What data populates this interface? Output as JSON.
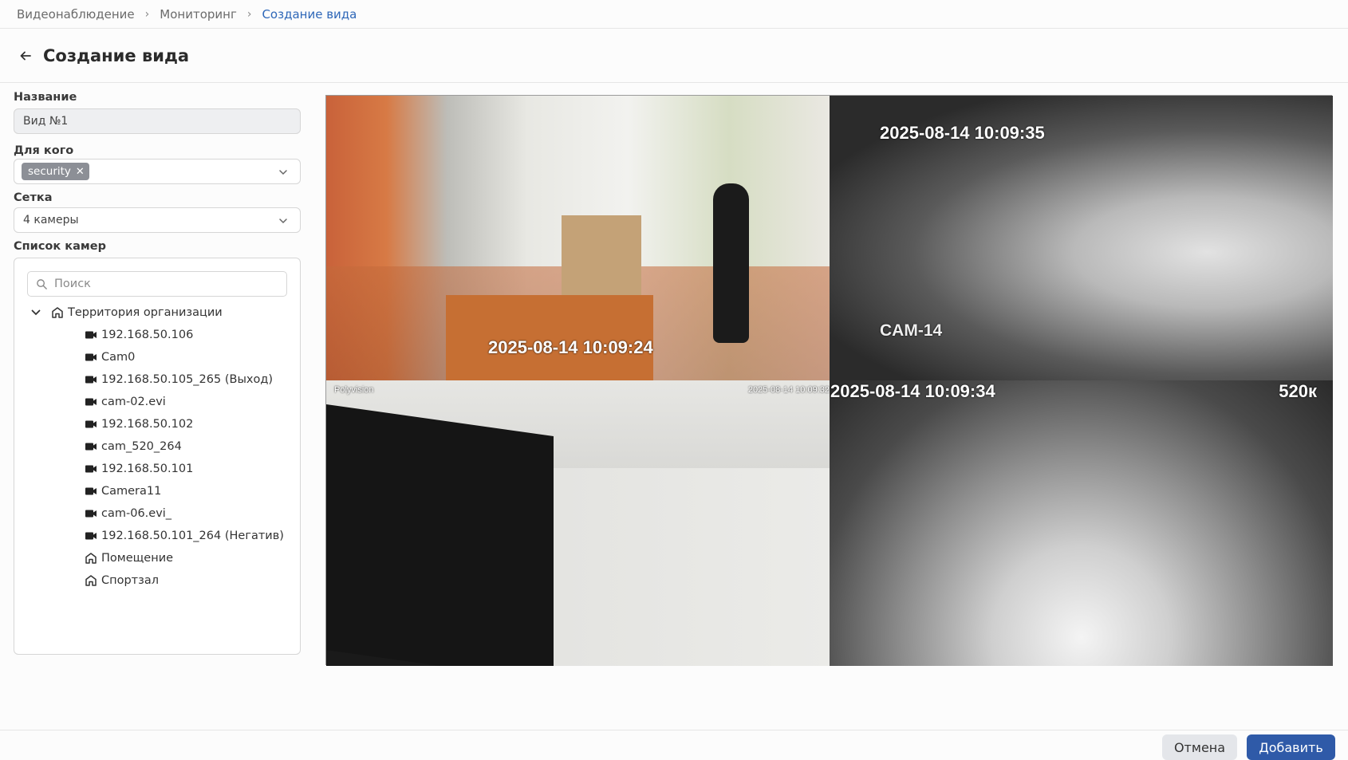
{
  "breadcrumb": [
    "Видеонаблюдение",
    "Мониторинг",
    "Создание вида"
  ],
  "page": {
    "title": "Создание вида"
  },
  "form": {
    "name_label": "Название",
    "name_value": "Вид №1",
    "for_whom_label": "Для кого",
    "for_whom_tag": "security",
    "grid_label": "Сетка",
    "grid_value": "4 камеры",
    "camera_list_label": "Список камер",
    "search_placeholder": "Поиск"
  },
  "tree": {
    "root": "Территория организации",
    "items": [
      {
        "label": "192.168.50.106",
        "type": "camera"
      },
      {
        "label": "Cam0",
        "type": "camera"
      },
      {
        "label": "192.168.50.105_265 (Выход)",
        "type": "camera"
      },
      {
        "label": "cam-02.evi",
        "type": "camera"
      },
      {
        "label": "192.168.50.102",
        "type": "camera"
      },
      {
        "label": "cam_520_264",
        "type": "camera"
      },
      {
        "label": "192.168.50.101",
        "type": "camera"
      },
      {
        "label": "Camera11",
        "type": "camera"
      },
      {
        "label": "cam-06.evi_",
        "type": "camera"
      },
      {
        "label": "192.168.50.101_264 (Негатив)",
        "type": "camera"
      },
      {
        "label": "Помещение",
        "type": "building"
      },
      {
        "label": "Спортзал",
        "type": "building"
      }
    ]
  },
  "video": {
    "tile1": {
      "timestamp": "2025-08-14 10:09:24"
    },
    "tile2": {
      "timestamp": "2025-08-14 10:09:35",
      "name": "CAM-14"
    },
    "tile3": {
      "brand": "Polyvision",
      "timestamp": "2025-08-14  10:09:32"
    },
    "tile4": {
      "timestamp": "2025-08-14 10:09:34",
      "label": "520к"
    }
  },
  "footer": {
    "cancel": "Отмена",
    "add": "Добавить"
  },
  "colors": {
    "accent": "#2e67b8",
    "primary_button": "#2f5aa8",
    "tag": "#8c8f96"
  }
}
